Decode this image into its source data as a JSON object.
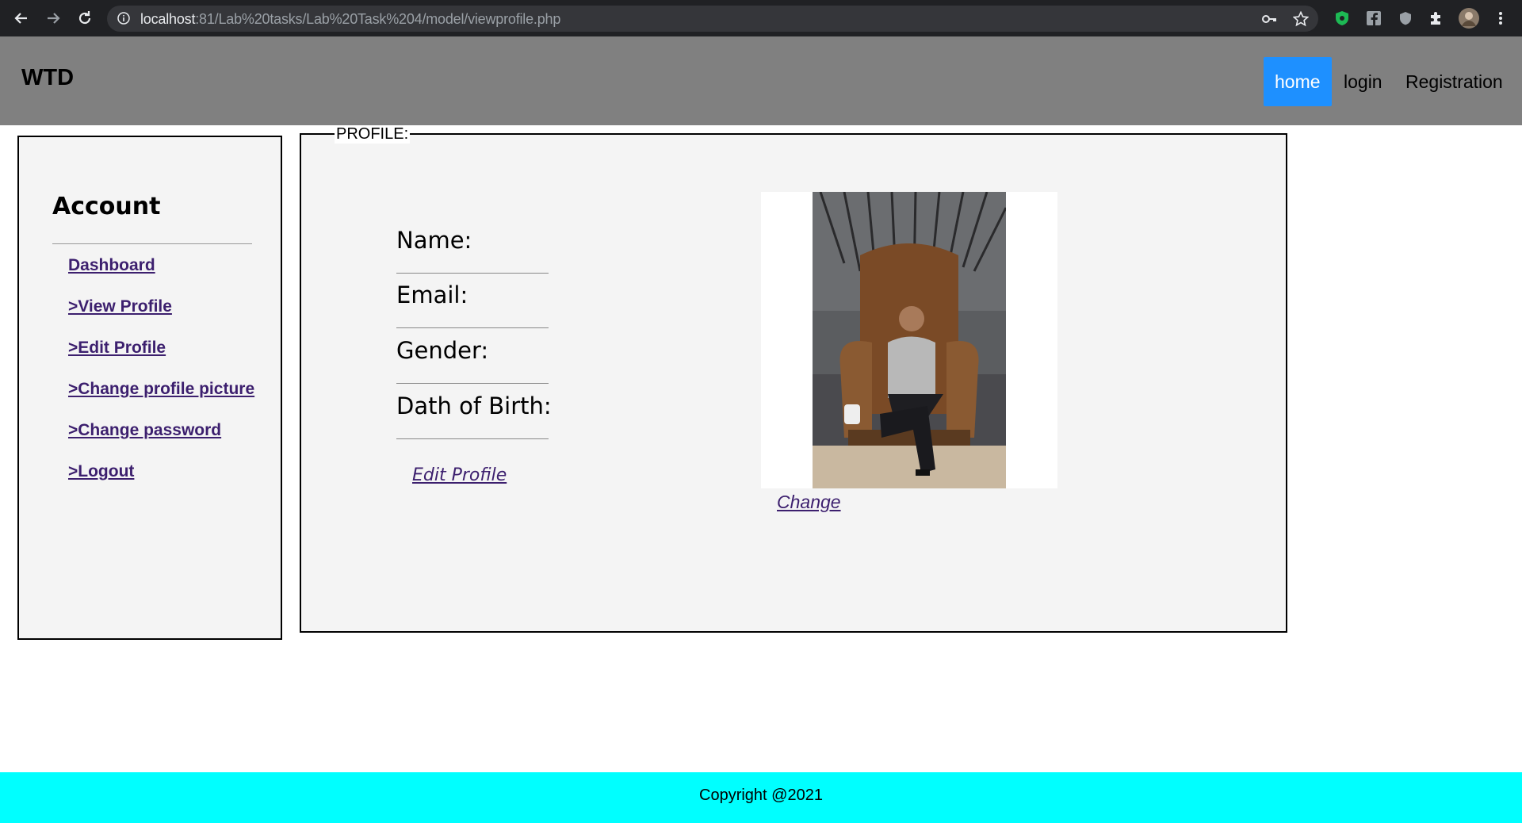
{
  "browser": {
    "url_host": "localhost",
    "url_rest": ":81/Lab%20tasks/Lab%20Task%204/model/viewprofile.php"
  },
  "header": {
    "brand": "WTD",
    "nav": [
      {
        "label": "home",
        "active": true
      },
      {
        "label": "login",
        "active": false
      },
      {
        "label": "Registration",
        "active": false
      }
    ]
  },
  "sidebar": {
    "title": "Account",
    "links": [
      {
        "label": "Dashboard"
      },
      {
        "label": ">View Profile"
      },
      {
        "label": ">Edit Profile"
      },
      {
        "label": ">Change profile picture"
      },
      {
        "label": ">Change password"
      },
      {
        "label": ">Logout"
      }
    ]
  },
  "profile": {
    "legend": "PROFILE:",
    "fields": [
      {
        "label": "Name:"
      },
      {
        "label": "Email:"
      },
      {
        "label": "Gender:"
      },
      {
        "label": "Dath of Birth:"
      }
    ],
    "edit_link": "Edit Profile",
    "change_link": "Change"
  },
  "footer": {
    "copyright": "Copyright @2021"
  },
  "colors": {
    "header_bg": "#808080",
    "active_nav": "#1e90ff",
    "footer_bg": "#00ffff",
    "link": "#3c1f6e",
    "panel_bg": "#f4f4f4"
  }
}
